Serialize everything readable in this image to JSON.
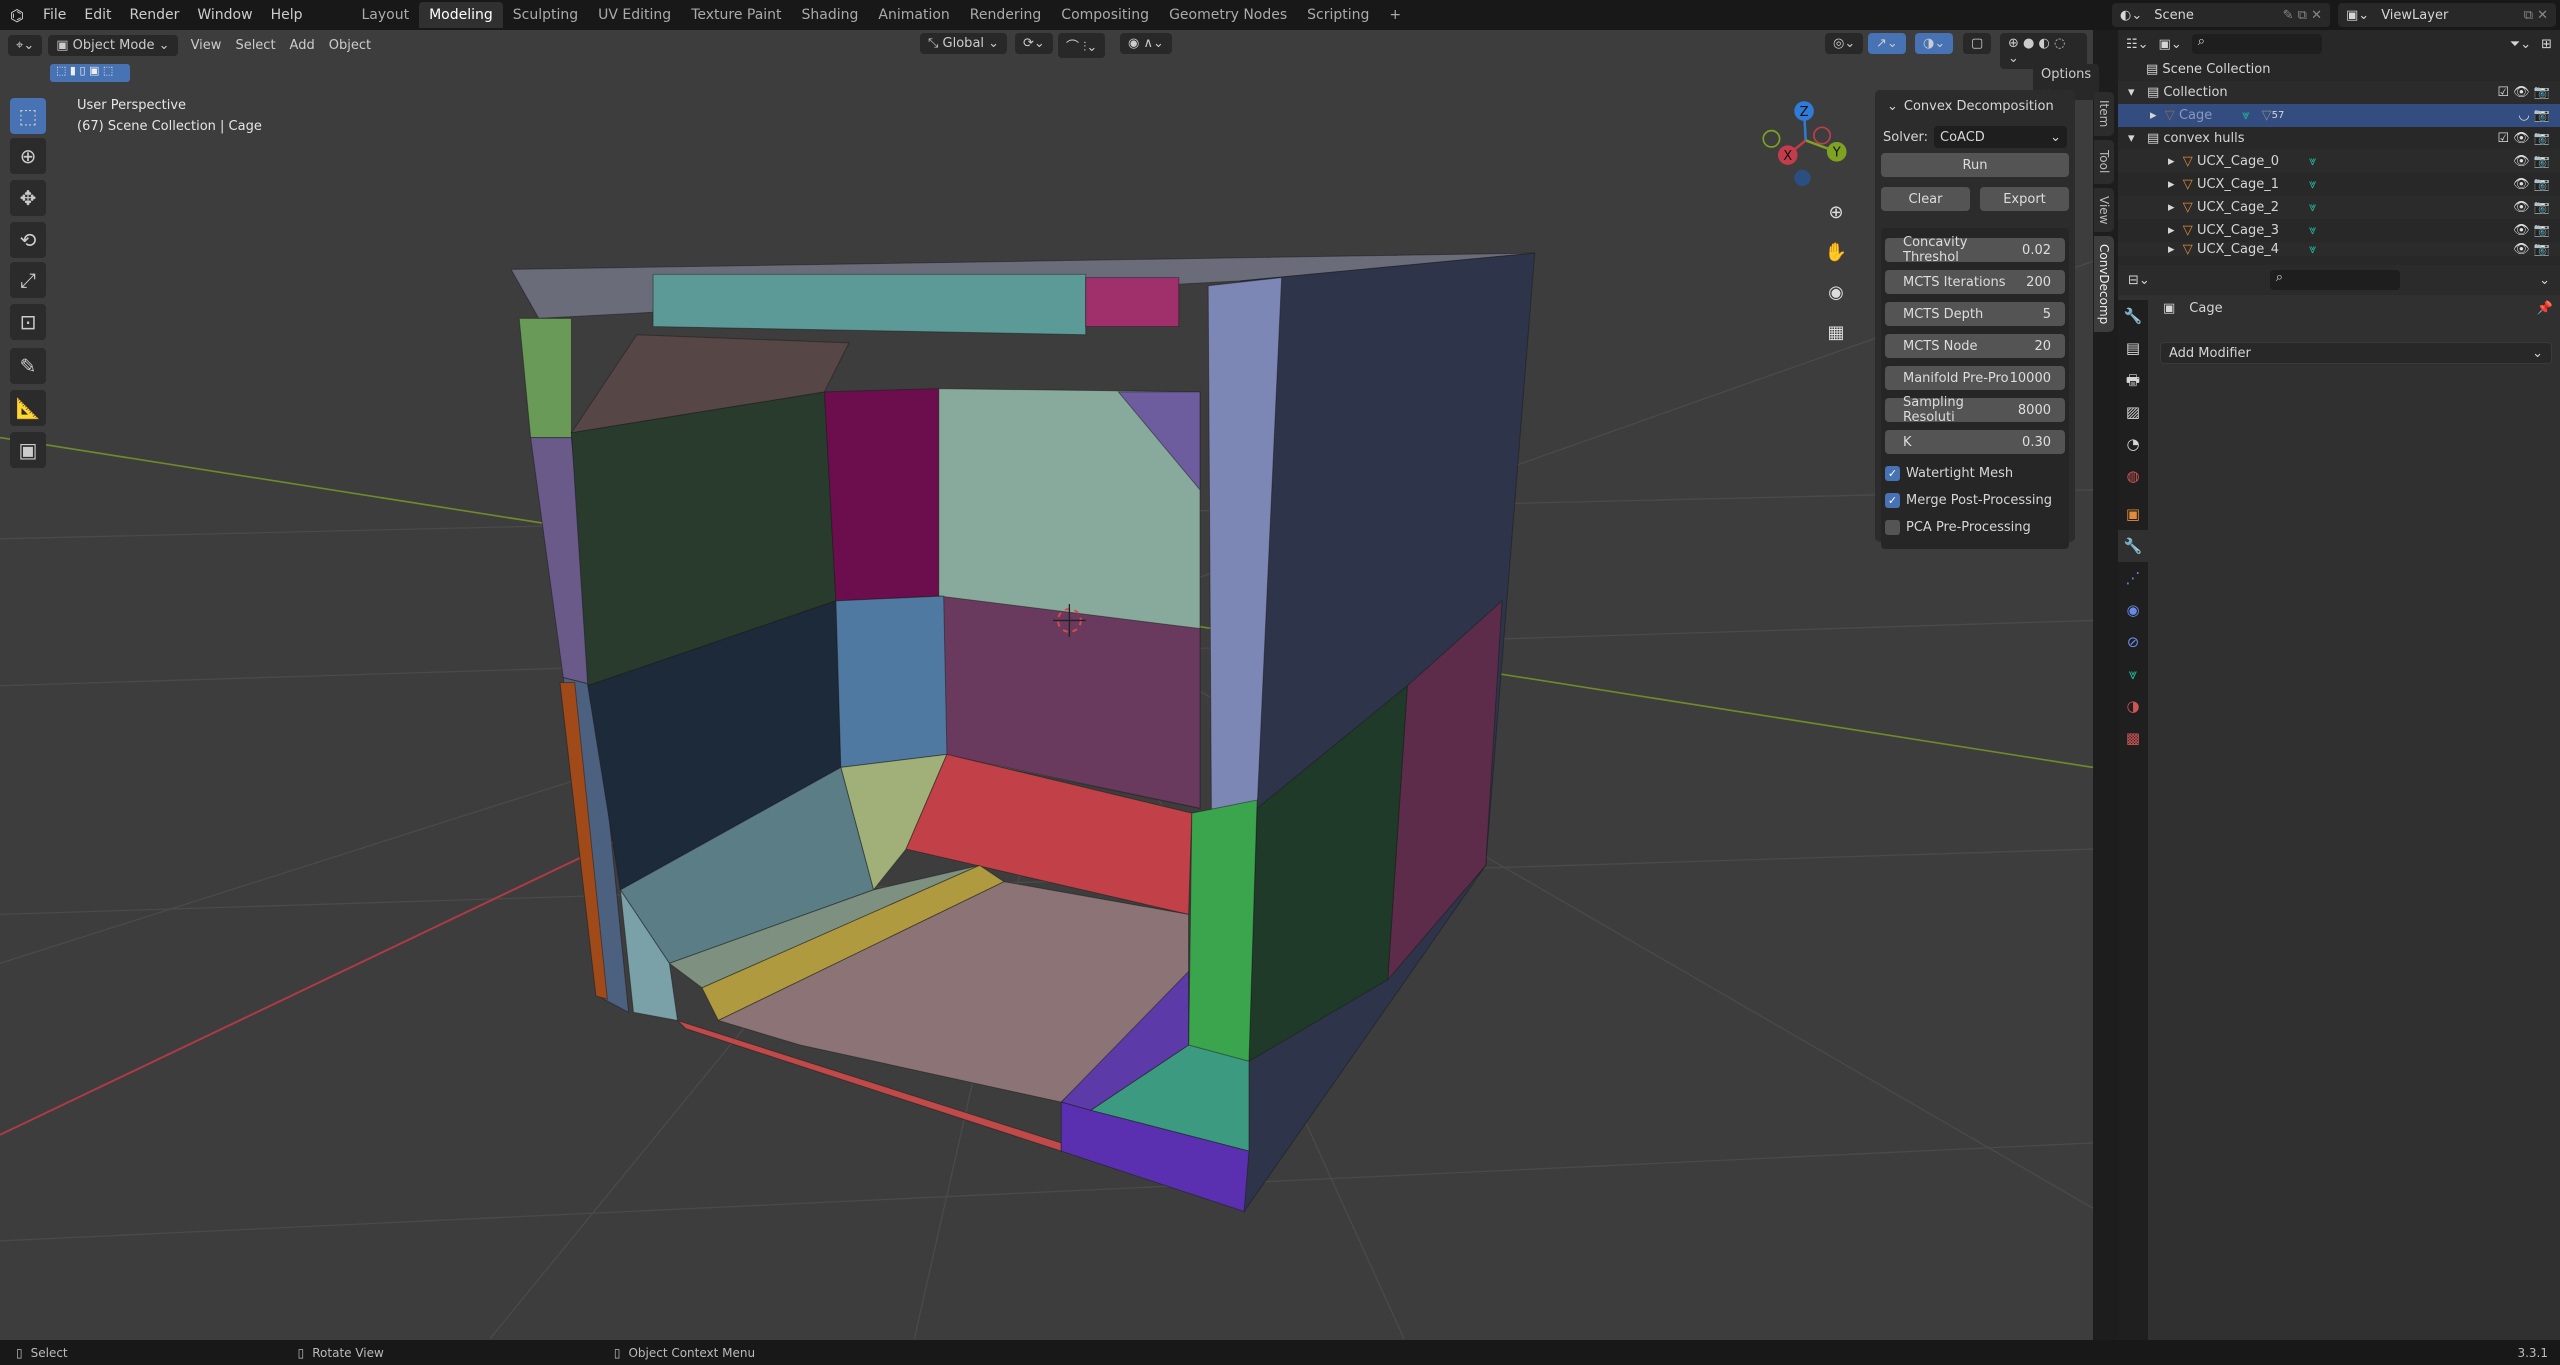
{
  "topbar": {
    "menus": [
      "File",
      "Edit",
      "Render",
      "Window",
      "Help"
    ],
    "workspaces": [
      "Layout",
      "Modeling",
      "Sculpting",
      "UV Editing",
      "Texture Paint",
      "Shading",
      "Animation",
      "Rendering",
      "Compositing",
      "Geometry Nodes",
      "Scripting"
    ],
    "active_workspace": "Modeling",
    "add_workspace": "+",
    "scene": "Scene",
    "view_layer": "ViewLayer"
  },
  "viewport_header": {
    "mode": "Object Mode",
    "menus": [
      "View",
      "Select",
      "Add",
      "Object"
    ],
    "orientation": "Global",
    "options": "Options"
  },
  "overlay": {
    "view_name": "User Perspective",
    "context": "(67) Scene Collection | Cage"
  },
  "gizmo": {
    "x": "X",
    "y": "Y",
    "z": "Z"
  },
  "npanel": {
    "title": "Convex Decomposition",
    "solver_label": "Solver:",
    "solver_value": "CoACD",
    "run": "Run",
    "clear": "Clear",
    "export": "Export",
    "fields": [
      {
        "label": "Concavity Threshol",
        "value": "0.02"
      },
      {
        "label": "MCTS Iterations",
        "value": "200"
      },
      {
        "label": "MCTS Depth",
        "value": "5"
      },
      {
        "label": "MCTS Node",
        "value": "20"
      },
      {
        "label": "Manifold Pre-Pro",
        "value": "10000"
      },
      {
        "label": "Sampling Resoluti",
        "value": "8000"
      },
      {
        "label": "K",
        "value": "0.30"
      }
    ],
    "checkboxes": [
      {
        "label": "Watertight Mesh",
        "checked": true
      },
      {
        "label": "Merge Post-Processing",
        "checked": true
      },
      {
        "label": "PCA Pre-Processing",
        "checked": false
      }
    ],
    "tabs": [
      "Item",
      "Tool",
      "View",
      "ConvDecomp"
    ],
    "active_tab": "ConvDecomp"
  },
  "outliner": {
    "root": "Scene Collection",
    "collection": "Collection",
    "selected": "Cage",
    "badge": "57",
    "hulls_collection": "convex hulls",
    "hulls": [
      "UCX_Cage_0",
      "UCX_Cage_1",
      "UCX_Cage_2",
      "UCX_Cage_3",
      "UCX_Cage_4"
    ]
  },
  "properties": {
    "object_name": "Cage",
    "add_modifier": "Add Modifier",
    "active_tab": "modifiers"
  },
  "statusbar": {
    "select": "Select",
    "rotate": "Rotate View",
    "context_menu": "Object Context Menu",
    "version": "3.3.1"
  },
  "colors": {
    "accent": "#4772b3",
    "selection": "#334d80",
    "x_axis": "#c33c4c",
    "y_axis": "#7ea323",
    "z_axis": "#2f7bd8"
  }
}
